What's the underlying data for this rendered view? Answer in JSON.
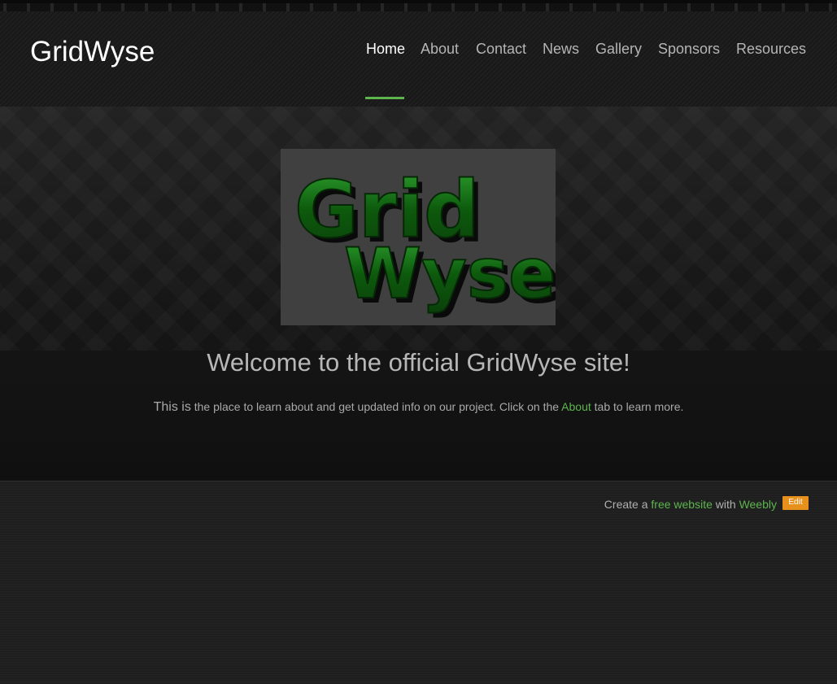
{
  "header": {
    "site_title": "GridWyse",
    "nav": [
      {
        "label": "Home",
        "active": true
      },
      {
        "label": "About"
      },
      {
        "label": "Contact"
      },
      {
        "label": "News"
      },
      {
        "label": "Gallery"
      },
      {
        "label": "Sponsors"
      },
      {
        "label": "Resources"
      }
    ]
  },
  "main": {
    "logo": {
      "line1": "Grid",
      "line2": "Wyse"
    },
    "welcome": "Welcome to the official GridWyse site!",
    "intro": {
      "lead": "This is",
      "text_before": " the place to learn about and get updated info on our project. Click on the ",
      "link": "About",
      "text_after": " tab to learn more."
    }
  },
  "footer": {
    "create_a": "Create a ",
    "free_website": "free website",
    "with": " with ",
    "weebly": "Weebly",
    "edit_label": "Edit"
  },
  "colors": {
    "accent": "#5db54e",
    "edit_badge": "#e8901c",
    "background": "#1c1c1c"
  }
}
